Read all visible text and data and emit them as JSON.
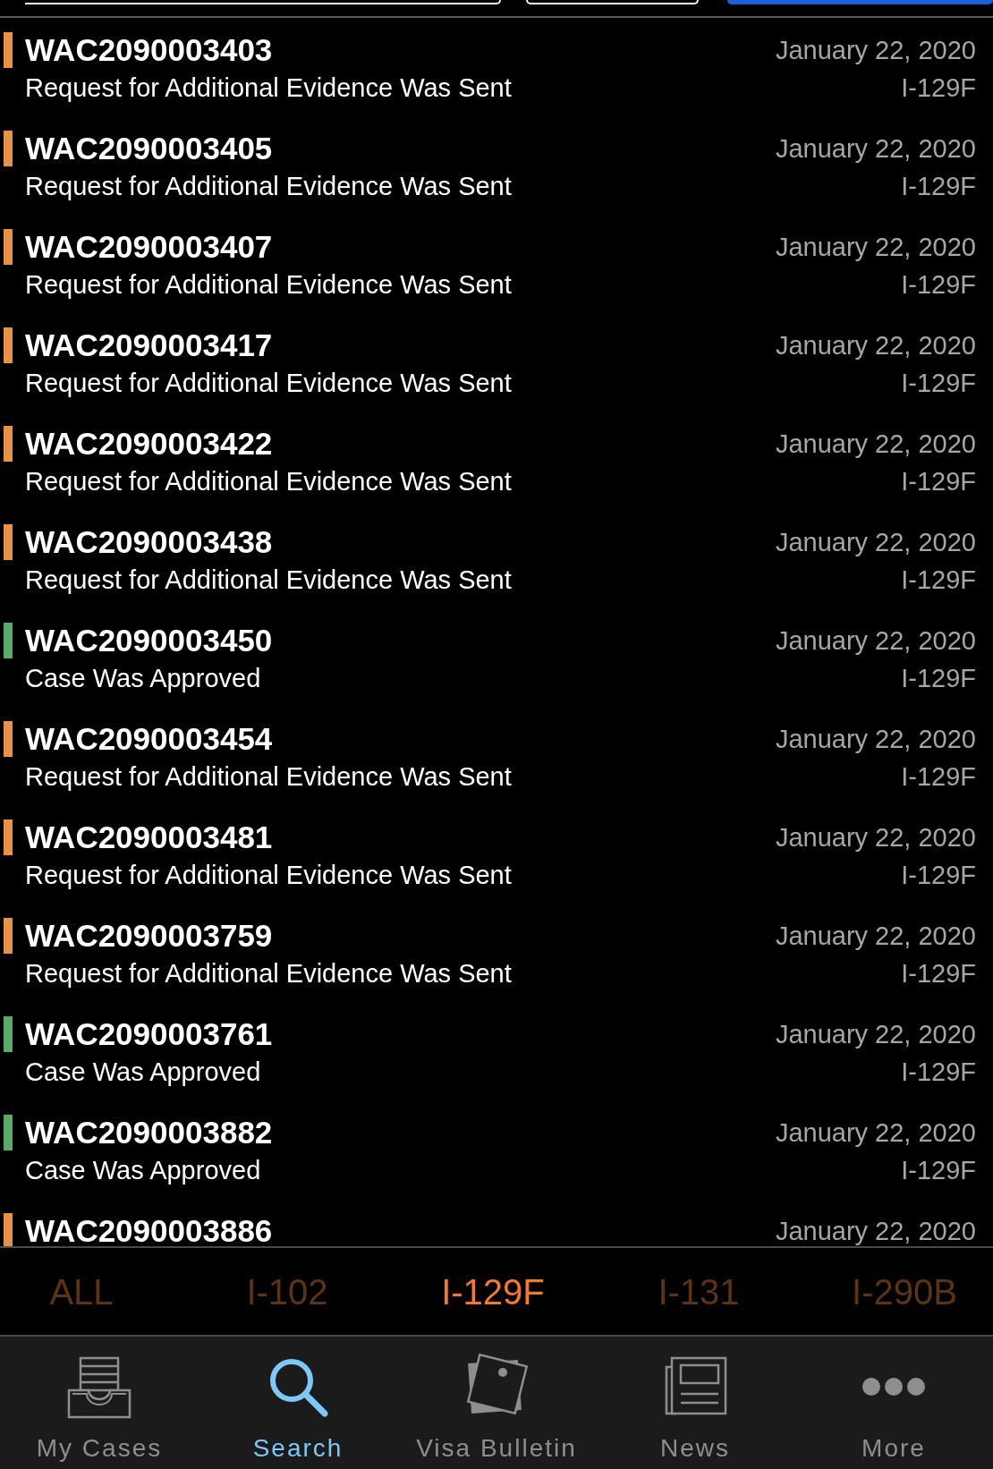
{
  "top_controls": [
    {
      "kind": "field"
    },
    {
      "kind": "field"
    },
    {
      "kind": "button"
    }
  ],
  "cases": [
    {
      "number": "WAC2090003403",
      "status": "Request for Additional Evidence Was Sent",
      "date": "January 22, 2020",
      "form": "I-129F",
      "color": "#e8914a"
    },
    {
      "number": "WAC2090003405",
      "status": "Request for Additional Evidence Was Sent",
      "date": "January 22, 2020",
      "form": "I-129F",
      "color": "#e8914a"
    },
    {
      "number": "WAC2090003407",
      "status": "Request for Additional Evidence Was Sent",
      "date": "January 22, 2020",
      "form": "I-129F",
      "color": "#e8914a"
    },
    {
      "number": "WAC2090003417",
      "status": "Request for Additional Evidence Was Sent",
      "date": "January 22, 2020",
      "form": "I-129F",
      "color": "#e8914a"
    },
    {
      "number": "WAC2090003422",
      "status": "Request for Additional Evidence Was Sent",
      "date": "January 22, 2020",
      "form": "I-129F",
      "color": "#e8914a"
    },
    {
      "number": "WAC2090003438",
      "status": "Request for Additional Evidence Was Sent",
      "date": "January 22, 2020",
      "form": "I-129F",
      "color": "#e8914a"
    },
    {
      "number": "WAC2090003450",
      "status": "Case Was Approved",
      "date": "January 22, 2020",
      "form": "I-129F",
      "color": "#5aaa6a"
    },
    {
      "number": "WAC2090003454",
      "status": "Request for Additional Evidence Was Sent",
      "date": "January 22, 2020",
      "form": "I-129F",
      "color": "#e8914a"
    },
    {
      "number": "WAC2090003481",
      "status": "Request for Additional Evidence Was Sent",
      "date": "January 22, 2020",
      "form": "I-129F",
      "color": "#e8914a"
    },
    {
      "number": "WAC2090003759",
      "status": "Request for Additional Evidence Was Sent",
      "date": "January 22, 2020",
      "form": "I-129F",
      "color": "#e8914a"
    },
    {
      "number": "WAC2090003761",
      "status": "Case Was Approved",
      "date": "January 22, 2020",
      "form": "I-129F",
      "color": "#5aaa6a"
    },
    {
      "number": "WAC2090003882",
      "status": "Case Was Approved",
      "date": "January 22, 2020",
      "form": "I-129F",
      "color": "#5aaa6a"
    },
    {
      "number": "WAC2090003886",
      "date": "January 22, 2020",
      "color": "#e8914a"
    }
  ],
  "filters": [
    {
      "label": "ALL",
      "selected": false
    },
    {
      "label": "I-102",
      "selected": false
    },
    {
      "label": "I-129F",
      "selected": true
    },
    {
      "label": "I-131",
      "selected": false
    },
    {
      "label": "I-290B",
      "selected": false
    }
  ],
  "tab_bar": [
    {
      "label": "My Cases",
      "selected": false
    },
    {
      "label": "Search",
      "selected": true
    },
    {
      "label": "Visa Bulletin",
      "selected": false
    },
    {
      "label": "News",
      "selected": false
    },
    {
      "label": "More",
      "selected": false
    }
  ]
}
